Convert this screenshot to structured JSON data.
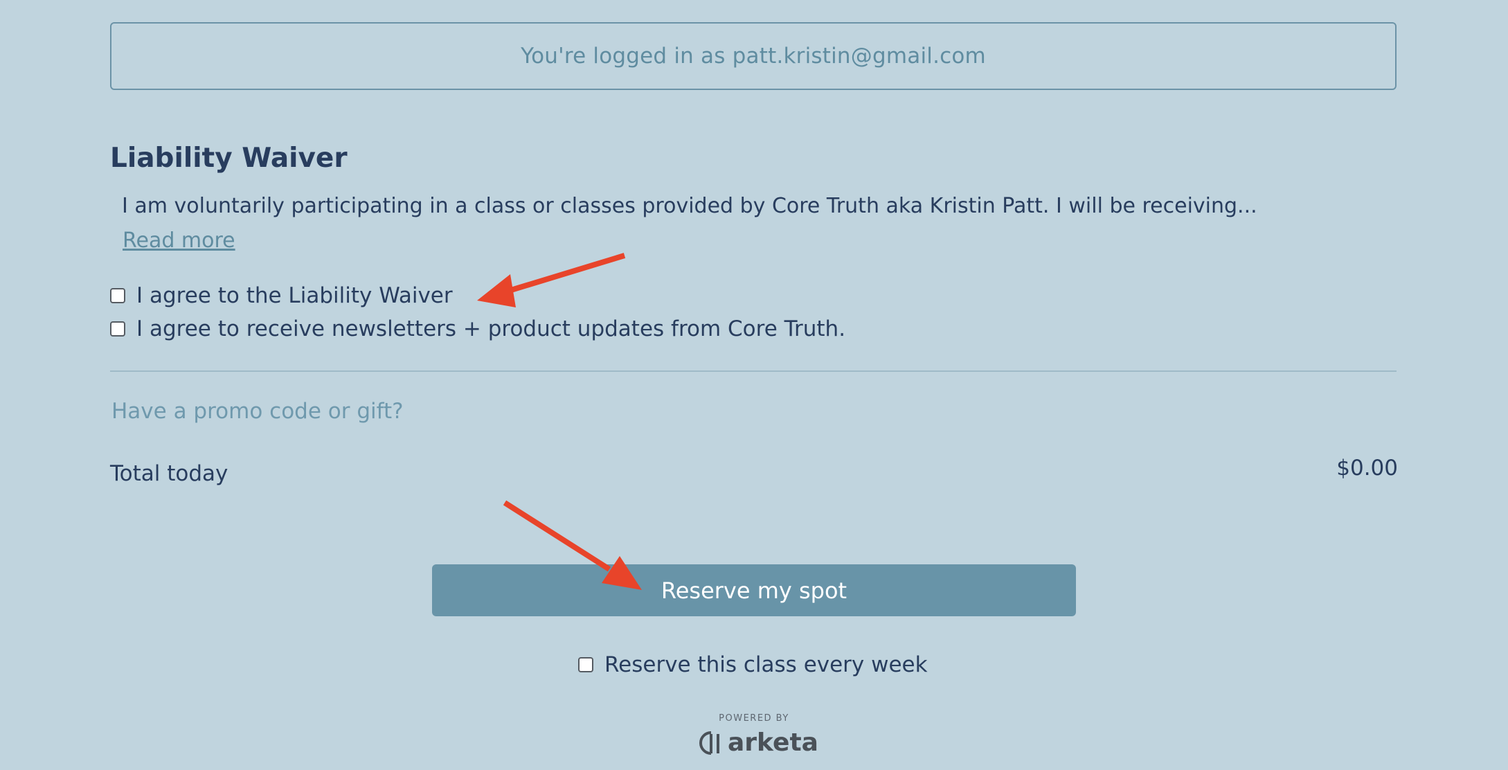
{
  "account": {
    "logged_in_text": "You're logged in as patt.kristin@gmail.com"
  },
  "waiver": {
    "title": "Liability Waiver",
    "excerpt": "I am voluntarily participating in a class or classes provided by Core Truth aka Kristin Patt. I will be receiving...",
    "read_more_label": "Read more",
    "agree_label": "I agree to the Liability Waiver",
    "agree_checked": false,
    "newsletter_label": "I agree to receive newsletters + product updates from Core Truth.",
    "newsletter_checked": false
  },
  "promo": {
    "label": "Have a promo code or gift?"
  },
  "total": {
    "label": "Total today",
    "amount": "$0.00"
  },
  "actions": {
    "reserve_label": "Reserve my spot",
    "weekly_label": "Reserve this class every week",
    "weekly_checked": false
  },
  "footer": {
    "powered_by": "POWERED BY",
    "brand_name": "arketa",
    "brand_icon": "arketa-logo-icon"
  },
  "colors": {
    "background": "#c0d4de",
    "text": "#283d5e",
    "accent": "#6894a8",
    "annotation_arrow": "#e8442a"
  }
}
